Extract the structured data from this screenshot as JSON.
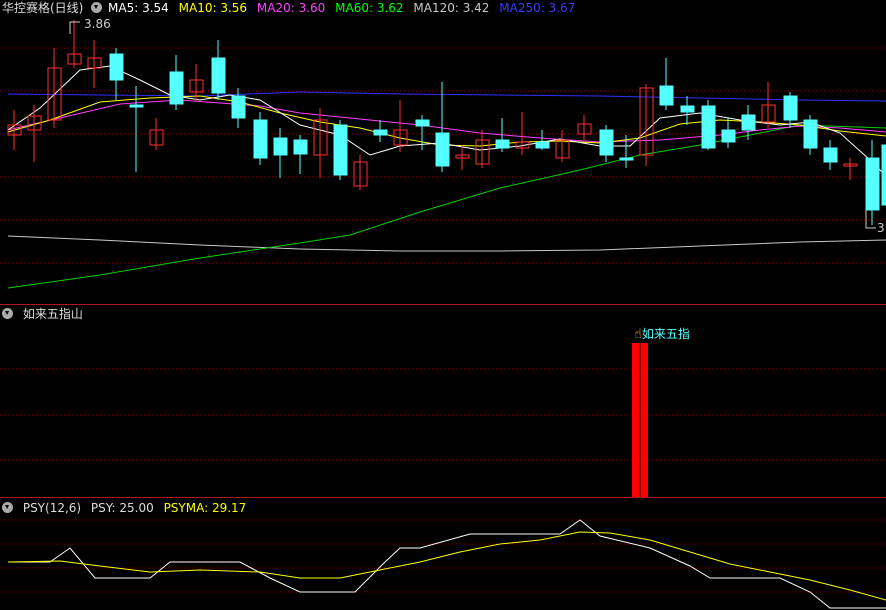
{
  "main": {
    "title": "华控赛格(日线)",
    "ma": [
      {
        "label": "MA5: 3.54",
        "color": "#ffffff"
      },
      {
        "label": "MA10: 3.56",
        "color": "#ffff00"
      },
      {
        "label": "MA20: 3.60",
        "color": "#ff40ff"
      },
      {
        "label": "MA60: 3.62",
        "color": "#00ff00"
      },
      {
        "label": "MA120: 3.42",
        "color": "#c8c8c8"
      },
      {
        "label": "MA250: 3.67",
        "color": "#3030ff"
      }
    ],
    "high_label": "3.86",
    "low_label": "3"
  },
  "ind1": {
    "title": "如来五指山",
    "signal_label": "如来五指",
    "signal_color": "#ff0000"
  },
  "ind2": {
    "title": "PSY(12,6)",
    "psy": "PSY: 25.00",
    "psyma": "PSYMA: 29.17",
    "psy_color": "#ffffff",
    "psyma_color": "#ffff00"
  },
  "colors": {
    "up": "#ff3030",
    "down": "#54ffff",
    "grid": "#8b0000",
    "separator": "#b01818"
  }
}
